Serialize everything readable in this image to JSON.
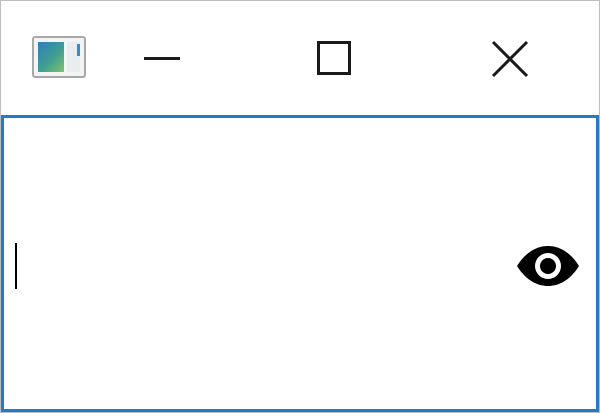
{
  "window": {
    "icon": "app-window-icon",
    "controls": {
      "minimize_icon": "minimize-icon",
      "maximize_icon": "maximize-icon",
      "close_icon": "close-icon"
    }
  },
  "password_field": {
    "value": "",
    "placeholder": "",
    "reveal_icon": "eye-icon",
    "focus_color": "#1f7ccd"
  }
}
